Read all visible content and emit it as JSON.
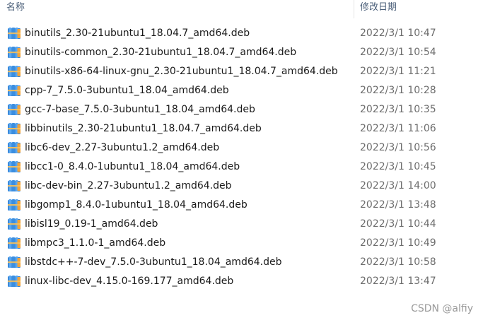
{
  "header": {
    "name_col": "名称",
    "date_col": "修改日期"
  },
  "files": [
    {
      "name": "binutils_2.30-21ubuntu1_18.04.7_amd64.deb",
      "modified": "2022/3/1 10:47",
      "icon": "archive-package-icon"
    },
    {
      "name": "binutils-common_2.30-21ubuntu1_18.04.7_amd64.deb",
      "modified": "2022/3/1 10:54",
      "icon": "archive-package-icon"
    },
    {
      "name": "binutils-x86-64-linux-gnu_2.30-21ubuntu1_18.04.7_amd64.deb",
      "modified": "2022/3/1 11:21",
      "icon": "archive-package-icon"
    },
    {
      "name": "cpp-7_7.5.0-3ubuntu1_18.04_amd64.deb",
      "modified": "2022/3/1 10:28",
      "icon": "archive-package-icon"
    },
    {
      "name": "gcc-7-base_7.5.0-3ubuntu1_18.04_amd64.deb",
      "modified": "2022/3/1 10:35",
      "icon": "archive-package-icon"
    },
    {
      "name": "libbinutils_2.30-21ubuntu1_18.04.7_amd64.deb",
      "modified": "2022/3/1 11:06",
      "icon": "archive-package-icon"
    },
    {
      "name": "libc6-dev_2.27-3ubuntu1.2_amd64.deb",
      "modified": "2022/3/1 10:56",
      "icon": "archive-package-icon"
    },
    {
      "name": "libcc1-0_8.4.0-1ubuntu1_18.04_amd64.deb",
      "modified": "2022/3/1 10:45",
      "icon": "archive-package-icon"
    },
    {
      "name": "libc-dev-bin_2.27-3ubuntu1.2_amd64.deb",
      "modified": "2022/3/1 14:00",
      "icon": "archive-package-icon"
    },
    {
      "name": "libgomp1_8.4.0-1ubuntu1_18.04_amd64.deb",
      "modified": "2022/3/1 13:48",
      "icon": "archive-package-icon"
    },
    {
      "name": "libisl19_0.19-1_amd64.deb",
      "modified": "2022/3/1 10:44",
      "icon": "archive-package-icon"
    },
    {
      "name": "libmpc3_1.1.0-1_amd64.deb",
      "modified": "2022/3/1 10:49",
      "icon": "archive-package-icon"
    },
    {
      "name": "libstdc++-7-dev_7.5.0-3ubuntu1_18.04_amd64.deb",
      "modified": "2022/3/1 10:58",
      "icon": "archive-package-icon"
    },
    {
      "name": "linux-libc-dev_4.15.0-169.177_amd64.deb",
      "modified": "2022/3/1 13:47",
      "icon": "archive-package-icon"
    }
  ],
  "watermark": "CSDN @alfiy",
  "colors": {
    "header_text": "#4c607a",
    "date_text": "#6d6d6d",
    "icon_book_blue": "#3b8ee0",
    "icon_book_orange": "#f2a33a"
  }
}
